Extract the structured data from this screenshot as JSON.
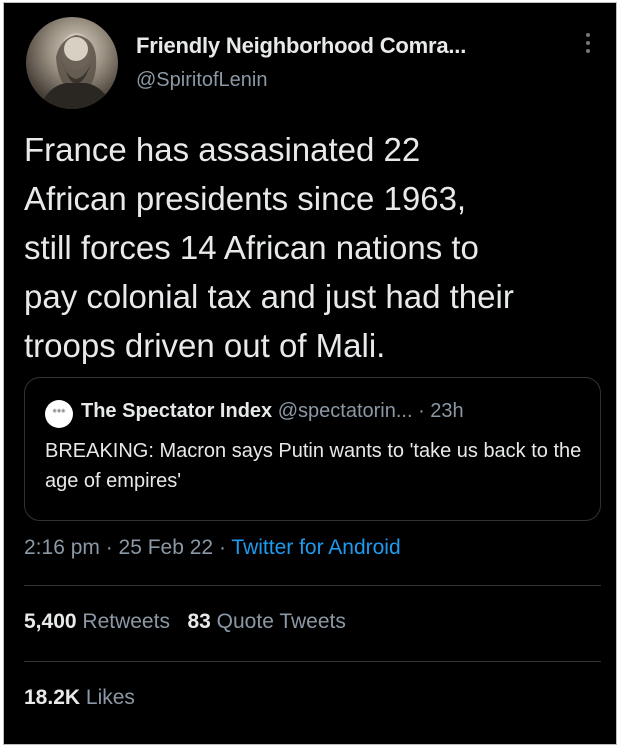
{
  "author": {
    "display_name": "Friendly Neighborhood Comra...",
    "handle": "@SpiritofLenin"
  },
  "tweet": {
    "text": "France has assasinated 22\nAfrican presidents since 1963,\nstill forces 14 African nations to\npay colonial tax and just had their\ntroops driven out of Mali."
  },
  "quoted_tweet": {
    "name": "The Spectator Index",
    "handle": "@spectatorin...",
    "time": "· 23h",
    "text": "BREAKING: Macron says Putin wants to 'take us back to the age of empires'"
  },
  "meta": {
    "time": "2:16 pm · 25 Feb 22 · ",
    "source": "Twitter for Android"
  },
  "stats": {
    "retweets": {
      "count": "5,400",
      "label": "Retweets"
    },
    "quote_tweets": {
      "count": "83",
      "label": "Quote Tweets"
    },
    "likes": {
      "count": "18.2K",
      "label": "Likes"
    }
  },
  "icons": {
    "more": "more-vertical-icon"
  },
  "colors": {
    "background": "#000000",
    "text": "#e7e9ea",
    "secondary": "#8b98a5",
    "link": "#1d9bf0",
    "border": "#2f3336"
  }
}
